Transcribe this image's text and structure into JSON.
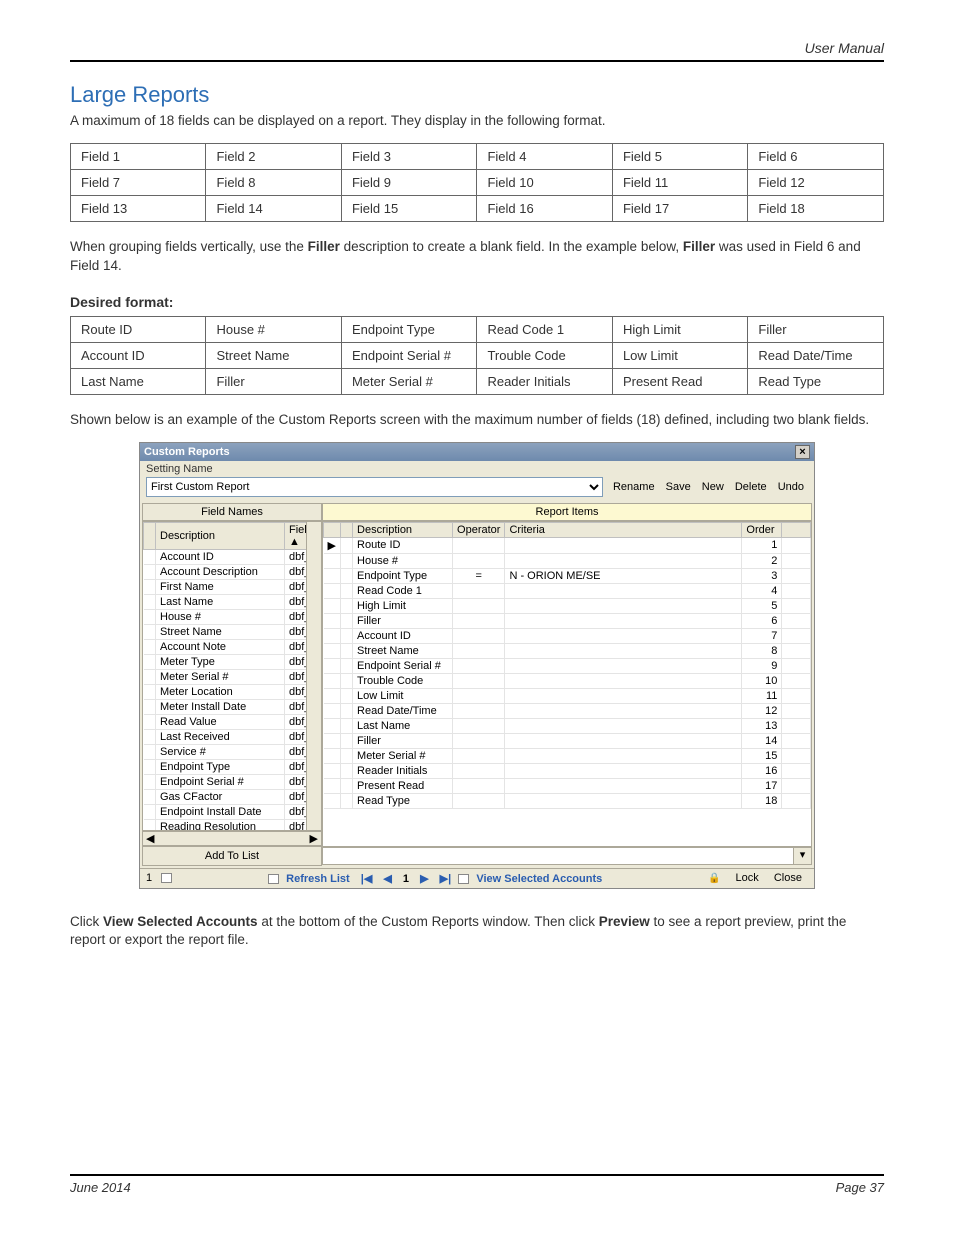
{
  "header": {
    "doc_title": "User Manual"
  },
  "footer": {
    "date": "June 2014",
    "page": "Page 37"
  },
  "section": {
    "title": "Large Reports",
    "intro": "A maximum of 18 fields can be displayed on a report. They display in the following format.",
    "fields_table": [
      [
        "Field 1",
        "Field 2",
        "Field 3",
        "Field 4",
        "Field 5",
        "Field 6"
      ],
      [
        "Field 7",
        "Field 8",
        "Field 9",
        "Field 10",
        "Field 11",
        "Field 12"
      ],
      [
        "Field 13",
        "Field 14",
        "Field 15",
        "Field 16",
        "Field 17",
        "Field 18"
      ]
    ],
    "para2_a": "When grouping fields vertically, use the ",
    "para2_b": "Filler",
    "para2_c": " description to create a blank field. In the example below, ",
    "para2_d": "Filler",
    "para2_e": " was used in Field 6 and Field 14.",
    "desired_format_label": "Desired format:",
    "desired_table": [
      [
        "Route ID",
        "House #",
        "Endpoint Type",
        "Read Code 1",
        "High Limit",
        "Filler"
      ],
      [
        "Account ID",
        "Street Name",
        "Endpoint Serial #",
        "Trouble Code",
        "Low Limit",
        "Read Date/Time"
      ],
      [
        "Last Name",
        "Filler",
        "Meter Serial #",
        "Reader Initials",
        "Present Read",
        "Read Type"
      ]
    ],
    "para3": "Shown below is an example of the Custom Reports screen with the maximum number of fields (18) defined, including two blank fields.",
    "para4_a": "Click ",
    "para4_b": "View Selected Accounts",
    "para4_c": " at the bottom of the Custom Reports window. Then click ",
    "para4_d": "Preview",
    "para4_e": " to see a report preview, print the report or export the report file."
  },
  "dialog": {
    "title": "Custom Reports",
    "close": "×",
    "setting_name_label": "Setting Name",
    "setting_value": "First Custom Report",
    "actions": {
      "rename": "Rename",
      "save": "Save",
      "new": "New",
      "delete": "Delete",
      "undo": "Undo"
    },
    "left": {
      "header": "Field Names",
      "cols": {
        "desc": "Description",
        "field": "Field"
      },
      "rows": [
        {
          "d": "Account ID",
          "f": "dbf_"
        },
        {
          "d": "Account Description",
          "f": "dbf_"
        },
        {
          "d": "First Name",
          "f": "dbf_"
        },
        {
          "d": "Last Name",
          "f": "dbf_"
        },
        {
          "d": "House #",
          "f": "dbf_"
        },
        {
          "d": "Street Name",
          "f": "dbf_"
        },
        {
          "d": "Account Note",
          "f": "dbf_"
        },
        {
          "d": "Meter Type",
          "f": "dbf_"
        },
        {
          "d": "Meter Serial #",
          "f": "dbf_"
        },
        {
          "d": "Meter Location",
          "f": "dbf_"
        },
        {
          "d": "Meter Install Date",
          "f": "dbf_"
        },
        {
          "d": "Read Value",
          "f": "dbf_"
        },
        {
          "d": "Last Received",
          "f": "dbf_"
        },
        {
          "d": "Service #",
          "f": "dbf_"
        },
        {
          "d": "Endpoint Type",
          "f": "dbf_"
        },
        {
          "d": "Endpoint Serial #",
          "f": "dbf_"
        },
        {
          "d": "Gas CFactor",
          "f": "dbf_"
        },
        {
          "d": "Endpoint Install Date",
          "f": "dbf_"
        },
        {
          "d": "Reading Resolution",
          "f": "dbf_"
        }
      ],
      "add_button": "Add To List"
    },
    "right": {
      "header": "Report Items",
      "cols": {
        "desc": "Description",
        "op": "Operator",
        "crit": "Criteria",
        "ord": "Order"
      },
      "rows": [
        {
          "d": "Route ID",
          "o": "",
          "c": "",
          "n": "1"
        },
        {
          "d": "House #",
          "o": "",
          "c": "",
          "n": "2"
        },
        {
          "d": "Endpoint Type",
          "o": "=",
          "c": "N - ORION ME/SE",
          "n": "3"
        },
        {
          "d": "Read Code 1",
          "o": "",
          "c": "",
          "n": "4"
        },
        {
          "d": "High Limit",
          "o": "",
          "c": "",
          "n": "5"
        },
        {
          "d": "Filler",
          "o": "",
          "c": "",
          "n": "6"
        },
        {
          "d": "Account ID",
          "o": "",
          "c": "",
          "n": "7"
        },
        {
          "d": "Street Name",
          "o": "",
          "c": "",
          "n": "8"
        },
        {
          "d": "Endpoint Serial #",
          "o": "",
          "c": "",
          "n": "9"
        },
        {
          "d": "Trouble Code",
          "o": "",
          "c": "",
          "n": "10"
        },
        {
          "d": "Low Limit",
          "o": "",
          "c": "",
          "n": "11"
        },
        {
          "d": "Read Date/Time",
          "o": "",
          "c": "",
          "n": "12"
        },
        {
          "d": "Last Name",
          "o": "",
          "c": "",
          "n": "13"
        },
        {
          "d": "Filler",
          "o": "",
          "c": "",
          "n": "14"
        },
        {
          "d": "Meter Serial #",
          "o": "",
          "c": "",
          "n": "15"
        },
        {
          "d": "Reader Initials",
          "o": "",
          "c": "",
          "n": "16"
        },
        {
          "d": "Present Read",
          "o": "",
          "c": "",
          "n": "17"
        },
        {
          "d": "Read Type",
          "o": "",
          "c": "",
          "n": "18"
        }
      ]
    },
    "bottom": {
      "page_no": "1",
      "refresh": "Refresh List",
      "pager_first": "|◀",
      "pager_prev": "◀",
      "pager_cur": "1",
      "pager_next": "▶",
      "pager_last": "▶|",
      "view_selected": "View Selected Accounts",
      "lock": "Lock",
      "close": "Close"
    }
  }
}
